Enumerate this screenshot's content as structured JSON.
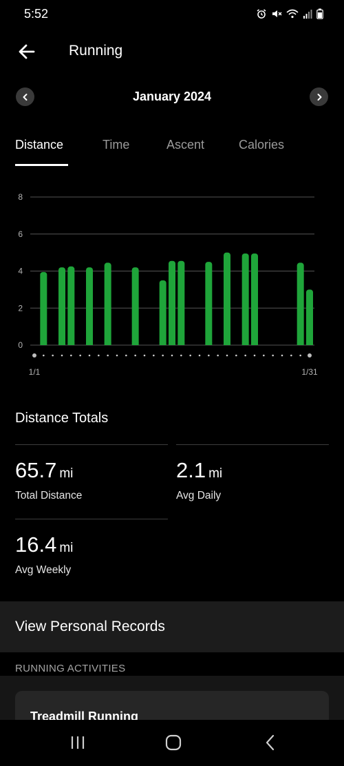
{
  "status_bar": {
    "time": "5:52",
    "icons": [
      "alarm-icon",
      "mute-icon",
      "wifi-icon",
      "signal-icon",
      "battery-icon"
    ]
  },
  "header": {
    "title": "Running",
    "back_icon": "arrow-left-icon"
  },
  "month_nav": {
    "label": "January 2024",
    "prev_icon": "chevron-left-icon",
    "next_icon": "chevron-right-icon"
  },
  "tabs": [
    {
      "label": "Distance",
      "active": true
    },
    {
      "label": "Time",
      "active": false
    },
    {
      "label": "Ascent",
      "active": false
    },
    {
      "label": "Calories",
      "active": false
    }
  ],
  "chart_data": {
    "type": "bar",
    "title": "",
    "xlabel": "",
    "ylabel": "",
    "ylim": [
      0,
      8
    ],
    "yticks": [
      "0",
      "2",
      "4",
      "6",
      "8"
    ],
    "grid": true,
    "x_tick_labels": {
      "first": "1/1",
      "last": "1/31"
    },
    "categories": [
      "1/1",
      "1/2",
      "1/3",
      "1/4",
      "1/5",
      "1/6",
      "1/7",
      "1/8",
      "1/9",
      "1/10",
      "1/11",
      "1/12",
      "1/13",
      "1/14",
      "1/15",
      "1/16",
      "1/17",
      "1/18",
      "1/19",
      "1/20",
      "1/21",
      "1/22",
      "1/23",
      "1/24",
      "1/25",
      "1/26",
      "1/27",
      "1/28",
      "1/29",
      "1/30",
      "1/31"
    ],
    "values": [
      0,
      3.95,
      0,
      4.2,
      4.25,
      0,
      4.2,
      0,
      4.45,
      0,
      0,
      4.2,
      0,
      0,
      3.5,
      4.55,
      4.55,
      0,
      0,
      4.5,
      0,
      5.0,
      0,
      4.95,
      4.95,
      0,
      0,
      0,
      0,
      4.45,
      3.0
    ],
    "color": "#1fa53a"
  },
  "totals": {
    "title": "Distance Totals",
    "stats": [
      {
        "value": "65.7",
        "unit": "mi",
        "label": "Total Distance"
      },
      {
        "value": "2.1",
        "unit": "mi",
        "label": "Avg Daily"
      },
      {
        "value": "16.4",
        "unit": "mi",
        "label": "Avg Weekly"
      }
    ]
  },
  "records": {
    "label": "View Personal Records"
  },
  "activities": {
    "header": "RUNNING ACTIVITIES",
    "items": [
      {
        "title": "Treadmill Running"
      }
    ]
  },
  "nav_bar": {
    "icons": [
      "recents-icon",
      "home-icon",
      "back-icon"
    ]
  },
  "colors": {
    "background": "#000000",
    "bar": "#1fa53a",
    "grid": "#555555",
    "tab_inactive": "#9b9b9b",
    "card": "#262626"
  }
}
